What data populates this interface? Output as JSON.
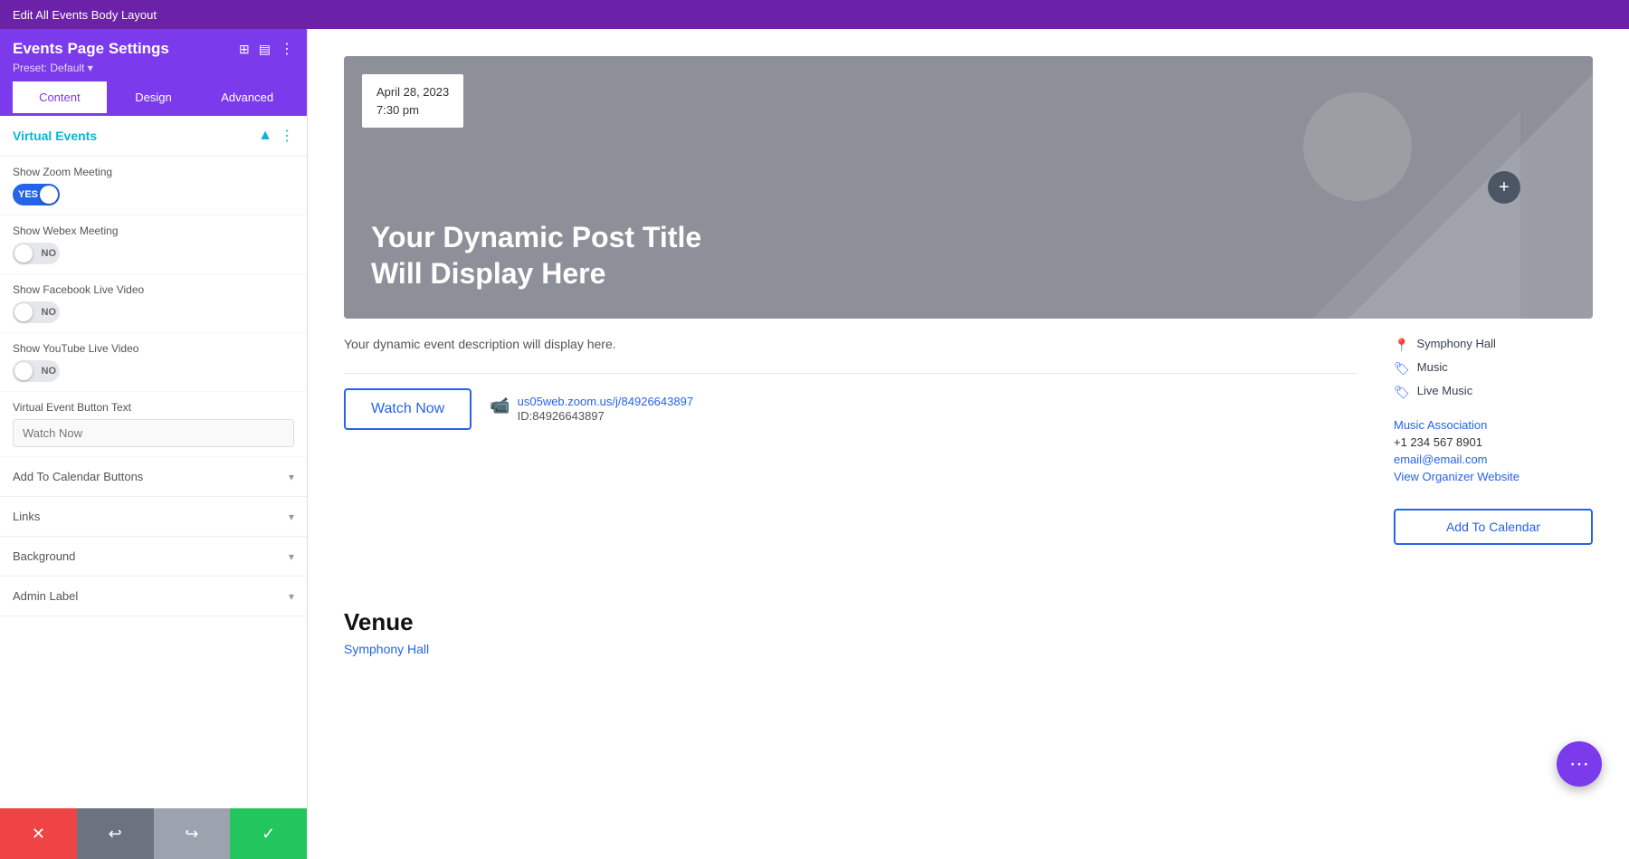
{
  "topBar": {
    "title": "Edit All Events Body Layout"
  },
  "sidebar": {
    "header": {
      "title": "Events Page Settings",
      "preset": "Preset: Default ▾",
      "tabs": [
        {
          "label": "Content",
          "active": true
        },
        {
          "label": "Design",
          "active": false
        },
        {
          "label": "Advanced",
          "active": false
        }
      ]
    },
    "sections": {
      "virtualEvents": {
        "label": "Virtual Events",
        "fields": [
          {
            "id": "show-zoom",
            "label": "Show Zoom Meeting",
            "toggleState": "on",
            "toggleText": "YES"
          },
          {
            "id": "show-webex",
            "label": "Show Webex Meeting",
            "toggleState": "off",
            "toggleText": "NO"
          },
          {
            "id": "show-facebook",
            "label": "Show Facebook Live Video",
            "toggleState": "off",
            "toggleText": "NO"
          },
          {
            "id": "show-youtube",
            "label": "Show YouTube Live Video",
            "toggleState": "off",
            "toggleText": "NO"
          },
          {
            "id": "button-text",
            "label": "Virtual Event Button Text",
            "inputValue": "",
            "inputPlaceholder": "Watch Now"
          }
        ]
      },
      "collapsibles": [
        {
          "label": "Add To Calendar Buttons"
        },
        {
          "label": "Links"
        },
        {
          "label": "Background"
        },
        {
          "label": "Admin Label"
        }
      ]
    },
    "footer": {
      "buttons": [
        {
          "id": "cancel",
          "icon": "✕",
          "type": "red"
        },
        {
          "id": "undo",
          "icon": "↩",
          "type": "gray-dark"
        },
        {
          "id": "redo",
          "icon": "↪",
          "type": "gray"
        },
        {
          "id": "save",
          "icon": "✓",
          "type": "green"
        }
      ]
    }
  },
  "preview": {
    "banner": {
      "date": "April 28, 2023",
      "time": "7:30 pm",
      "title": "Your Dynamic Post Title Will Display Here"
    },
    "description": "Your dynamic event description will display here.",
    "watchNowButton": "Watch Now",
    "zoomLink": "us05web.zoom.us/j/84926643897",
    "zoomId": "ID:84926643897",
    "sidebar": {
      "venue": "Symphony Hall",
      "tags": [
        "Music",
        "Live Music"
      ],
      "organizer": {
        "name": "Music Association",
        "phone": "+1 234 567 8901",
        "email": "email@email.com",
        "websiteLabel": "View Organizer Website"
      },
      "calendarButton": "Add To Calendar"
    },
    "venue": {
      "sectionTitle": "Venue",
      "venueName": "Symphony Hall"
    }
  },
  "fab": {
    "icon": "⋯"
  }
}
